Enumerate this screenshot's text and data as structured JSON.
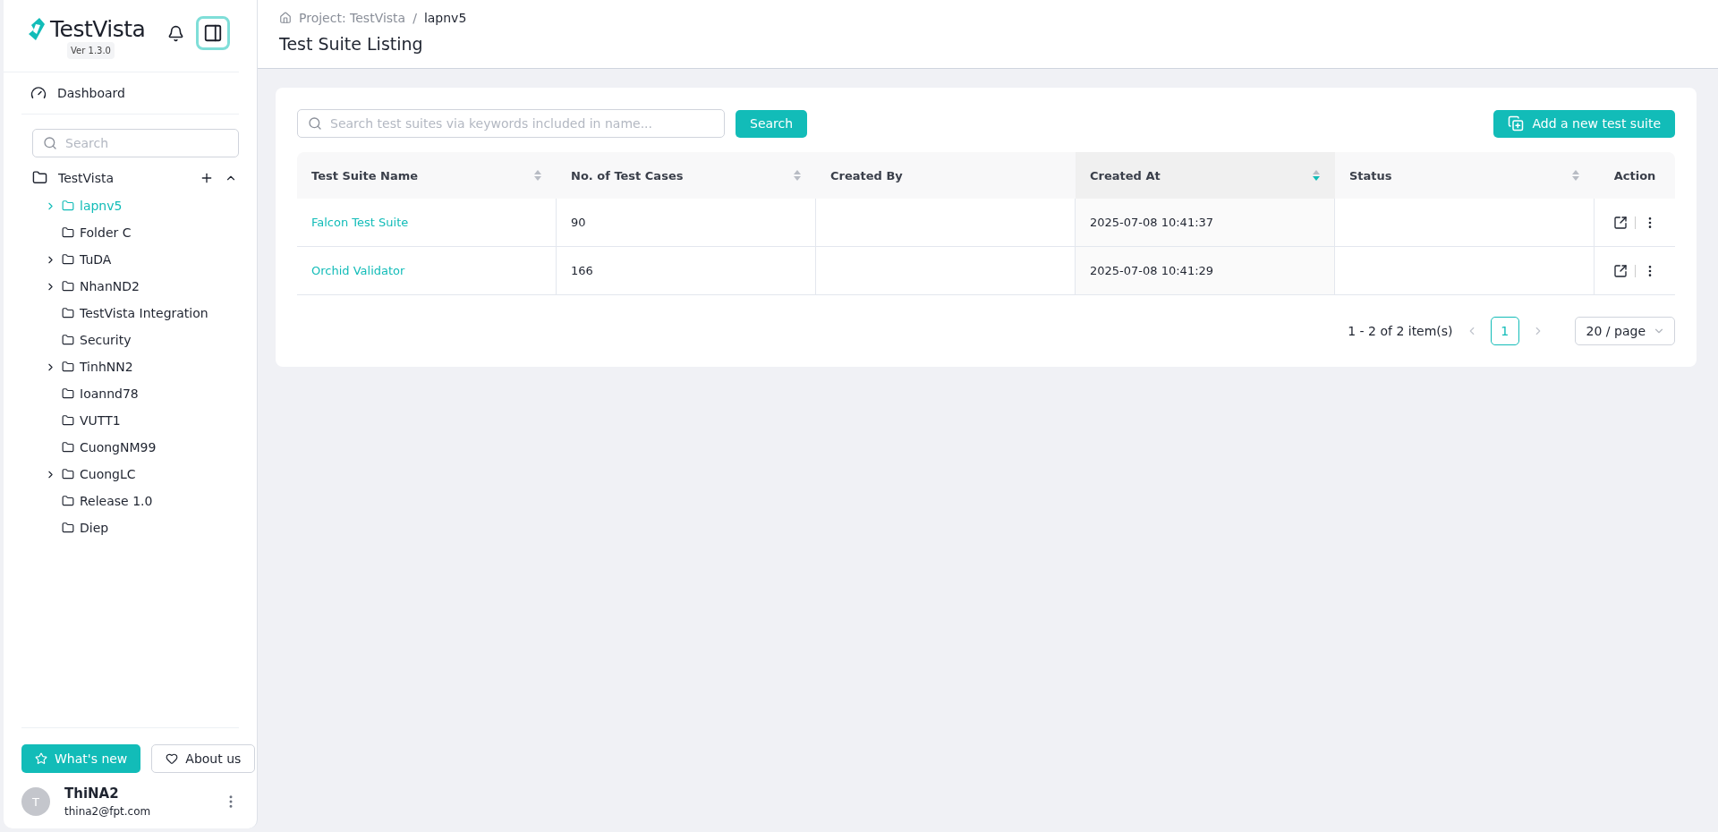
{
  "sidebar": {
    "brand": "TestVista",
    "version": "Ver 1.3.0",
    "nav": [
      {
        "label": "Dashboard"
      }
    ],
    "search": {
      "placeholder": "Search"
    },
    "tree": {
      "label": "TestVista",
      "expanded": true,
      "children": [
        {
          "label": "lapnv5",
          "selected": true,
          "expandable": true
        },
        {
          "label": "Folder C",
          "selected": false,
          "expandable": false
        },
        {
          "label": "TuDA",
          "selected": false,
          "expandable": true
        },
        {
          "label": "NhanND2",
          "selected": false,
          "expandable": true
        },
        {
          "label": "TestVista Integration",
          "selected": false,
          "expandable": false
        },
        {
          "label": "Security",
          "selected": false,
          "expandable": false
        },
        {
          "label": "TinhNN2",
          "selected": false,
          "expandable": true
        },
        {
          "label": "Ioannd78",
          "selected": false,
          "expandable": false
        },
        {
          "label": "VUTT1",
          "selected": false,
          "expandable": false
        },
        {
          "label": "CuongNM99",
          "selected": false,
          "expandable": false
        },
        {
          "label": "CuongLC",
          "selected": false,
          "expandable": true
        },
        {
          "label": "Release 1.0",
          "selected": false,
          "expandable": false
        },
        {
          "label": "Diep",
          "selected": false,
          "expandable": false
        }
      ]
    },
    "buttons": [
      {
        "label": "What's new",
        "kind": "primary"
      },
      {
        "label": "About us",
        "kind": "outline"
      }
    ],
    "user": {
      "initial": "T",
      "name": "ThiNA2",
      "email": "thina2@fpt.com"
    }
  },
  "header": {
    "breadcrumb": [
      "Project: TestVista",
      "lapnv5"
    ],
    "breadcrumb_separator": "/",
    "title": "Test Suite Listing"
  },
  "toolbar": {
    "search": {
      "placeholder": "Search test suites via keywords included in name..."
    },
    "search_button": "Search",
    "add_button": "Add a new test suite"
  },
  "table": {
    "columns": [
      {
        "label": "Test Suite Name",
        "sortable": true,
        "sorted": false
      },
      {
        "label": "No. of Test Cases",
        "sortable": true,
        "sorted": false
      },
      {
        "label": "Created By",
        "sortable": false
      },
      {
        "label": "Created At",
        "sortable": true,
        "sorted": true
      },
      {
        "label": "Status",
        "sortable": true,
        "sorted": false
      },
      {
        "label": "Action",
        "sortable": false
      }
    ],
    "rows": [
      {
        "name": "Falcon Test Suite",
        "cases": "90",
        "created_at": "2025-07-08 10:41:37"
      },
      {
        "name": "Orchid Validator",
        "cases": "166",
        "created_at": "2025-07-08 10:41:29"
      }
    ]
  },
  "pagination": {
    "summary": "1 - 2 of 2 item(s)",
    "pages": [
      {
        "label": "1",
        "selected": true
      }
    ],
    "page_size": "20 / page"
  }
}
